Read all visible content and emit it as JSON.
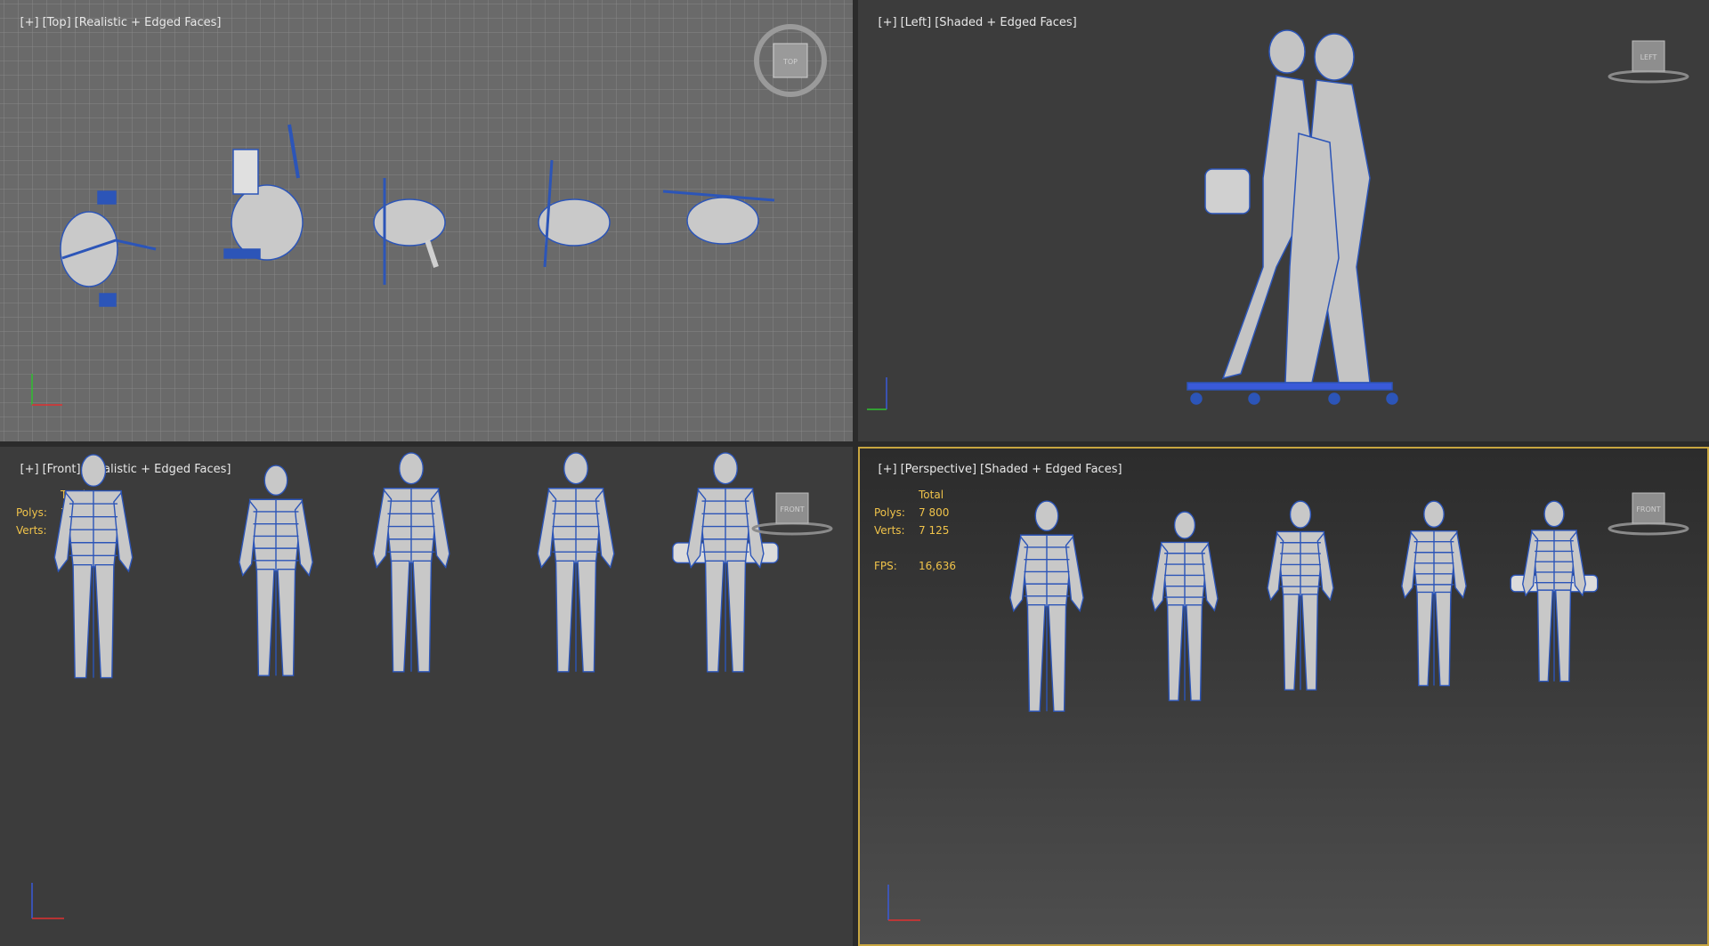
{
  "viewports": {
    "top": {
      "plus": "[+]",
      "view": "[Top]",
      "mode": "[Realistic + Edged Faces]",
      "cube": "TOP"
    },
    "left": {
      "plus": "[+]",
      "view": "[Left]",
      "mode": "[Shaded + Edged Faces]",
      "cube": "LEFT"
    },
    "front": {
      "plus": "[+]",
      "view": "[Front]",
      "mode": "[Realistic + Edged Faces]",
      "cube": "FRONT"
    },
    "perspective": {
      "plus": "[+]",
      "view": "[Perspective]",
      "mode": "[Shaded + Edged Faces]",
      "cube": "FRONT"
    }
  },
  "stats": {
    "header": "Total",
    "polys_label": "Polys:",
    "polys_value": "7 800",
    "verts_label": "Verts:",
    "verts_value": "7 125",
    "fps_label": "FPS:",
    "fps_value": "16,636"
  },
  "colors": {
    "grid_bg": "#6a6a6a",
    "viewport_bg": "#3c3c3c",
    "active_border": "#c8a640",
    "stat_text": "#f0c34a",
    "wire": "#2c55b8",
    "mesh": "#c9c9c9",
    "axis_x": "#e03030",
    "axis_y": "#30c030",
    "axis_z": "#3a5ad8"
  },
  "icons": [
    "viewcube-top-icon",
    "viewcube-left-icon",
    "viewcube-front-icon",
    "axis-tripod-icon"
  ]
}
